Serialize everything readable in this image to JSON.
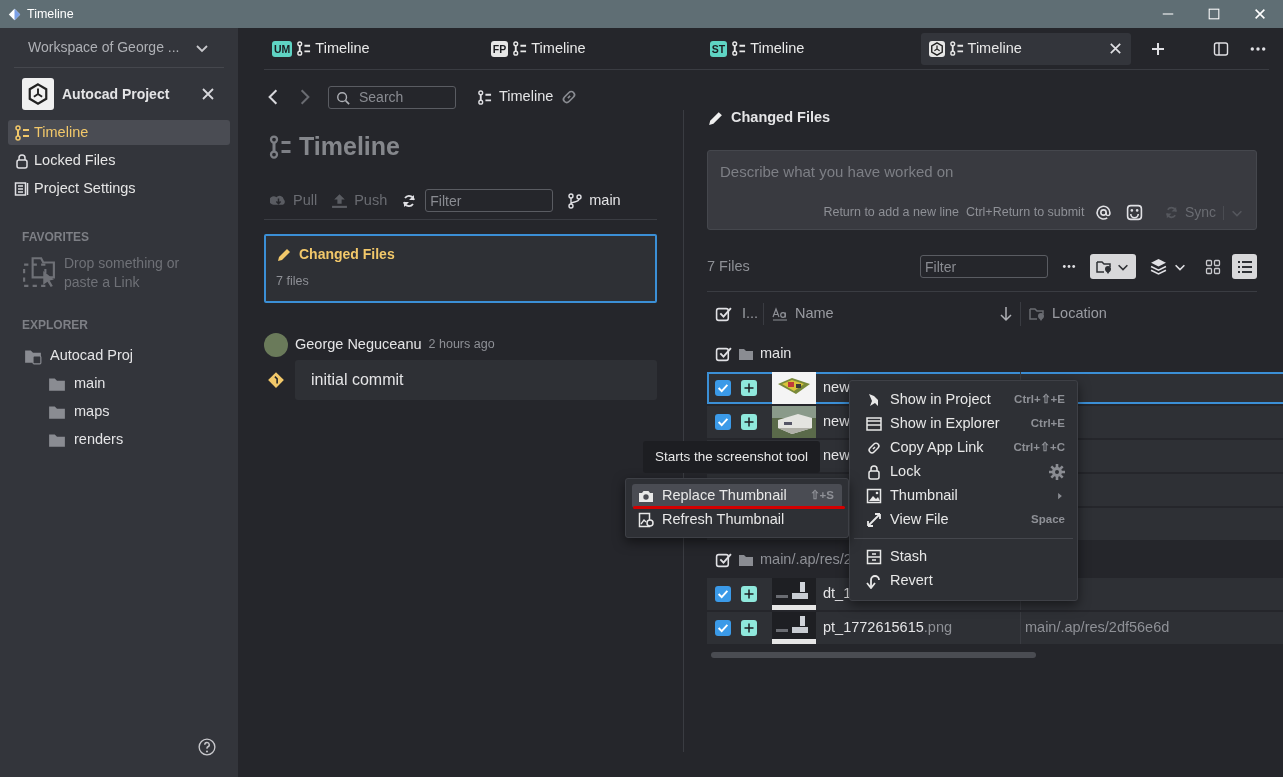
{
  "window": {
    "title": "Timeline"
  },
  "sidebar": {
    "workspace": "Workspace of George ...",
    "project": "Autocad Project",
    "nav": [
      {
        "label": "Timeline",
        "selected": true
      },
      {
        "label": "Locked Files",
        "selected": false
      },
      {
        "label": "Project Settings",
        "selected": false
      }
    ],
    "favorites": {
      "heading": "FAVORITES",
      "hint": "Drop something or paste a Link"
    },
    "explorer": {
      "heading": "EXPLORER",
      "tree": [
        {
          "label": "Autocad Proj",
          "children": [
            {
              "label": "main"
            },
            {
              "label": "maps"
            },
            {
              "label": "renders"
            }
          ]
        }
      ]
    }
  },
  "tabs": [
    {
      "badge": "UM",
      "color": "#5fd4c4",
      "label": "Timeline",
      "selected": false,
      "kind": "badge"
    },
    {
      "badge": "FP",
      "color": "#e6e6e6",
      "label": "Timeline",
      "selected": false,
      "kind": "badge"
    },
    {
      "badge": "ST",
      "color": "#5fd4c4",
      "label": "Timeline",
      "selected": false,
      "kind": "badge"
    },
    {
      "label": "Timeline",
      "selected": true,
      "kind": "logo"
    }
  ],
  "timeline": {
    "search": {
      "placeholder": "Search"
    },
    "breadcrumb": "Timeline",
    "heading": "Timeline",
    "toolbar": {
      "pull": {
        "label": "Pull",
        "disabled": true
      },
      "push": {
        "label": "Push",
        "disabled": true
      },
      "filter": {
        "placeholder": "Filter"
      },
      "branch": "main"
    },
    "changes_card": {
      "title": "Changed Files",
      "count": "7 files",
      "selected": true
    },
    "commits": [
      {
        "author": "George Neguceanu",
        "time": "2 hours ago",
        "message": "initial commit"
      }
    ]
  },
  "changed_files": {
    "heading": "Changed Files",
    "message": {
      "placeholder": "Describe what you have worked on"
    },
    "hints": [
      "Return to add a new line",
      "Ctrl+Return to submit"
    ],
    "sync": {
      "label": "Sync",
      "disabled": true
    },
    "count": "7 Files",
    "filter": {
      "placeholder": "Filter"
    },
    "views": [
      {
        "kind": "grid",
        "selected": false
      },
      {
        "kind": "list",
        "selected": true
      }
    ],
    "select_all": {
      "checked": true
    },
    "columns": [
      "I...",
      "Name",
      "Location"
    ],
    "groups": [
      {
        "label": "main",
        "checked": true,
        "rows": [
          {
            "checked": true,
            "name": "new",
            "selected": true
          },
          {
            "checked": true,
            "name": "new",
            "selected": false
          },
          {
            "name": "new",
            "selected": false
          },
          {
            "selected": false
          },
          {
            "selected": false
          }
        ]
      },
      {
        "label": "main/.ap/res/2",
        "checked": true,
        "rows": [
          {
            "checked": true,
            "name": "dt_1",
            "selected": false
          },
          {
            "checked": true,
            "name": "pt_1772615615",
            "ext": ".png",
            "location": "main/.ap/res/2df56e6d",
            "selected": false
          }
        ]
      }
    ]
  },
  "context_menu": [
    {
      "label": "Show in Project",
      "shortcut": "Ctrl+⇧+E",
      "kind": "item"
    },
    {
      "label": "Show in Explorer",
      "shortcut": "Ctrl+E",
      "kind": "item"
    },
    {
      "label": "Copy App Link",
      "shortcut": "Ctrl+⇧+C",
      "kind": "item"
    },
    {
      "label": "Lock",
      "kind": "gear"
    },
    {
      "label": "Thumbnail",
      "kind": "submenu"
    },
    {
      "label": "View File",
      "shortcut": "Space",
      "kind": "item"
    },
    {
      "kind": "separator"
    },
    {
      "label": "Stash",
      "kind": "item"
    },
    {
      "label": "Revert",
      "kind": "item"
    }
  ],
  "submenu": [
    {
      "label": "Replace Thumbnail",
      "shortcut": "⇧+S",
      "selected": true
    },
    {
      "label": "Refresh Thumbnail",
      "selected": false
    }
  ],
  "tooltip": "Starts the screenshot tool"
}
